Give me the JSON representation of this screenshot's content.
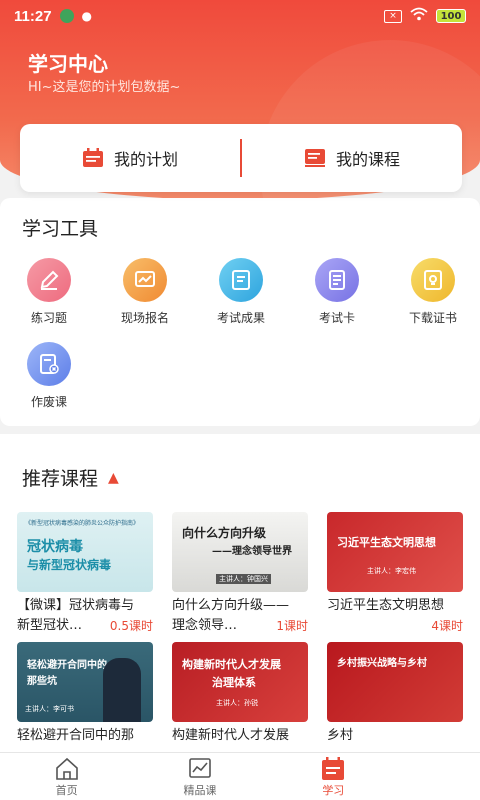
{
  "status": {
    "time": "11:27",
    "battery": "100"
  },
  "header": {
    "title": "学习中心",
    "subtitle": "HI~这是您的计划包数据~"
  },
  "plan_card": {
    "my_plan": "我的计划",
    "my_courses": "我的课程"
  },
  "tools": {
    "title": "学习工具",
    "items": [
      {
        "label": "练习题",
        "icon": "pencil-icon",
        "color": "#f07a8a"
      },
      {
        "label": "现场报名",
        "icon": "chart-icon",
        "color": "#f3a24a"
      },
      {
        "label": "考试成果",
        "icon": "certificate-icon",
        "color": "#46b6e6"
      },
      {
        "label": "考试卡",
        "icon": "card-icon",
        "color": "#8a86ee"
      },
      {
        "label": "下载证书",
        "icon": "badge-icon",
        "color": "#f2c93a"
      },
      {
        "label": "作废课",
        "icon": "cancel-doc-icon",
        "color": "#6f8ef0"
      }
    ]
  },
  "recommend": {
    "title": "推荐课程",
    "courses": [
      {
        "title": "【微课】冠状病毒与",
        "title2": "新型冠状…",
        "hours": "0.5课时",
        "thumb_lines": [
          "冠状病毒",
          "与新型冠状病毒"
        ],
        "thumb_header": "《新型冠状病毒感染的肺炎公众防护指南》"
      },
      {
        "title": "向什么方向升级——",
        "title2": "理念领导…",
        "hours": "1课时",
        "thumb_lines": [
          "向什么方向升级",
          "——理念领导世界"
        ],
        "thumb_footer": "主讲人：钟国兴"
      },
      {
        "title": "习近平生态文明思想",
        "title2": "",
        "hours": "4课时",
        "thumb_lines": [
          "习近平生态文明思想"
        ],
        "thumb_footer": "主讲人：李宏伟"
      },
      {
        "title": "轻松避开合同中的那",
        "hours": "",
        "thumb_lines": [
          "轻松避开合同中的",
          "那些坑"
        ],
        "thumb_footer": "主讲人：李可书"
      },
      {
        "title": "构建新时代人才发展",
        "hours": "",
        "thumb_lines": [
          "构建新时代人才发展",
          "治理体系"
        ],
        "thumb_footer": "主讲人：孙锐"
      },
      {
        "title": "乡村",
        "hours": "",
        "thumb_lines": [
          "乡村振兴战略与乡村"
        ]
      }
    ]
  },
  "tabbar": {
    "home": "首页",
    "featured": "精品课",
    "study": "学习"
  },
  "colors": {
    "accent": "#e84a36"
  }
}
